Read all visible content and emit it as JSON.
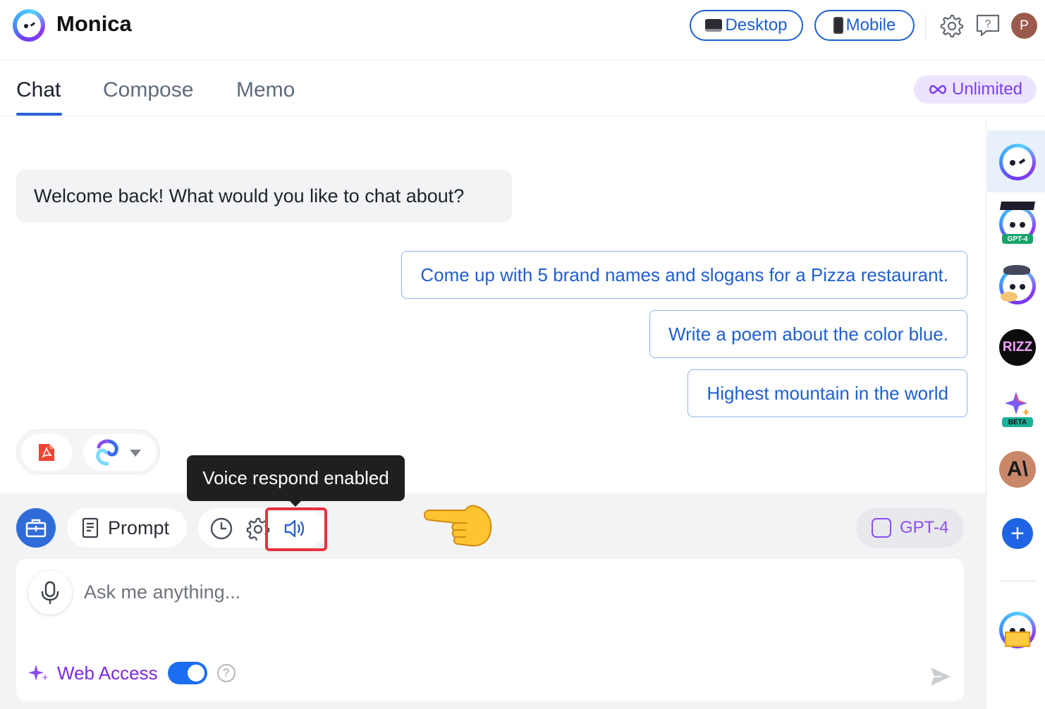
{
  "app": {
    "name": "Monica"
  },
  "header": {
    "desktop_label": "Desktop",
    "mobile_label": "Mobile",
    "avatar_initial": "P",
    "icons": [
      "settings-gear-icon",
      "help-chat-icon"
    ]
  },
  "tabs": [
    {
      "label": "Chat",
      "active": true
    },
    {
      "label": "Compose",
      "active": false
    },
    {
      "label": "Memo",
      "active": false
    }
  ],
  "plan_badge": {
    "label": "Unlimited"
  },
  "chat": {
    "welcome_message": "Welcome back! What would you like to chat about?",
    "suggestions": [
      "Come up with 5 brand names and slogans for a Pizza restaurant.",
      "Write a poem about the color blue.",
      "Highest mountain in the world"
    ]
  },
  "toolbar": {
    "prompt_label": "Prompt",
    "model_label": "GPT-4",
    "tooltip": "Voice respond enabled"
  },
  "input": {
    "placeholder": "Ask me anything...",
    "web_access_label": "Web Access",
    "web_access_enabled": true,
    "help_glyph": "?"
  },
  "sidebar": {
    "bots": [
      {
        "name": "monica-bot-icon",
        "active": true
      },
      {
        "name": "gpt4-bot-icon",
        "badge": "GPT-4"
      },
      {
        "name": "painter-bot-icon"
      },
      {
        "name": "rizz-bot-icon",
        "label": "RIZZ"
      },
      {
        "name": "gemini-bot-icon",
        "badge": "BETA"
      },
      {
        "name": "claude-bot-icon",
        "label": "A\\"
      },
      {
        "name": "add-bot-icon",
        "label": "+"
      },
      {
        "name": "mail-bot-icon"
      }
    ]
  },
  "colors": {
    "accent": "#2a62d5",
    "purple": "#7b3ff2",
    "highlight": "#e8303f"
  }
}
